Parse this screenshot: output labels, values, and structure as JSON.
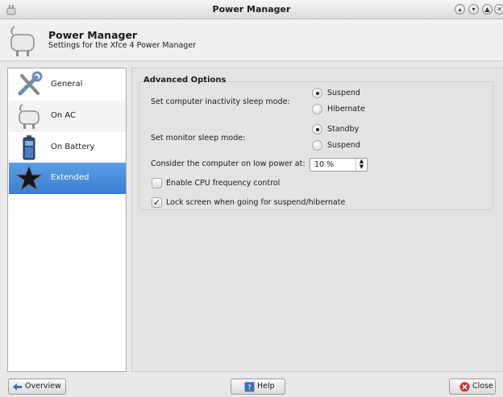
{
  "window": {
    "title": "Power Manager",
    "controls": [
      "minimize-icon",
      "shade-icon",
      "maximize-icon",
      "close-icon"
    ]
  },
  "header": {
    "title": "Power Manager",
    "subtitle": "Settings for the Xfce 4 Power Manager"
  },
  "sidebar": {
    "items": [
      {
        "label": "General",
        "icon": "tools-icon"
      },
      {
        "label": "On AC",
        "icon": "ac-plug-icon"
      },
      {
        "label": "On Battery",
        "icon": "battery-icon"
      },
      {
        "label": "Extended",
        "icon": "star-icon",
        "selected": true
      }
    ],
    "selection_color": "#3a7fd0"
  },
  "advanced": {
    "title": "Advanced Options",
    "inactivity_label": "Set computer inactivity sleep mode:",
    "inactivity_options": [
      "Suspend",
      "Hibernate"
    ],
    "inactivity_selected": "Suspend",
    "monitor_label": "Set monitor sleep mode:",
    "monitor_options": [
      "Standby",
      "Suspend"
    ],
    "monitor_selected": "Standby",
    "low_power_label": "Consider the computer on low power at:",
    "low_power_value": "10 %",
    "cpu_freq_label": "Enable CPU frequency control",
    "cpu_freq_checked": false,
    "lock_label": "Lock screen when going for suspend/hibernate",
    "lock_checked": true
  },
  "buttons": {
    "overview": "Overview",
    "help": "Help",
    "close": "Close"
  }
}
